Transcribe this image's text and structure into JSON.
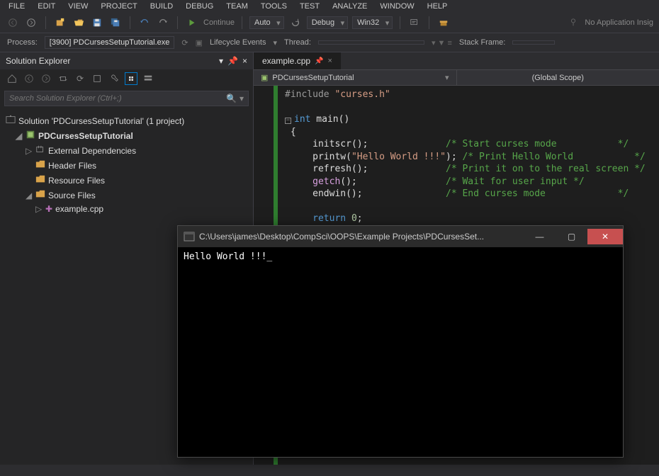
{
  "menu": [
    "FILE",
    "EDIT",
    "VIEW",
    "PROJECT",
    "BUILD",
    "DEBUG",
    "TEAM",
    "TOOLS",
    "TEST",
    "ANALYZE",
    "WINDOW",
    "HELP"
  ],
  "toolbar": {
    "continue_label": "Continue",
    "config": "Auto",
    "solution_config": "Debug",
    "platform": "Win32",
    "no_app": "No Application Insig"
  },
  "toolbar2": {
    "process_label": "Process:",
    "process_value": "[3900] PDCursesSetupTutorial.exe",
    "lifecycle": "Lifecycle Events",
    "thread": "Thread:",
    "stack": "Stack Frame:"
  },
  "sidebar": {
    "title": "Solution Explorer",
    "search_placeholder": "Search Solution Explorer (Ctrl+;)",
    "solution": "Solution 'PDCursesSetupTutorial' (1 project)",
    "project": "PDCursesSetupTutorial",
    "nodes": {
      "ext": "External Dependencies",
      "header": "Header Files",
      "resource": "Resource Files",
      "source": "Source Files",
      "example": "example.cpp"
    }
  },
  "editor": {
    "tab": "example.cpp",
    "scope_project": "PDCursesSetupTutorial",
    "scope_global": "(Global Scope)"
  },
  "code": {
    "lines": [
      {
        "t": "include",
        "pre": "#include ",
        "str": "\"curses.h\""
      },
      {
        "t": "blank"
      },
      {
        "t": "sig",
        "kw": "int",
        "rest": " main()",
        "box": true
      },
      {
        "t": "plain",
        "txt": "{"
      },
      {
        "t": "call",
        "fn": "initscr",
        "args": "();",
        "pad": "              ",
        "cmt": "/* Start curses mode           */"
      },
      {
        "t": "call",
        "fn": "printw",
        "args": "(",
        "str": "\"Hello World !!!\"",
        "post": ");",
        "pad": " ",
        "cmt": "/* Print Hello World           */"
      },
      {
        "t": "call",
        "fn": "refresh",
        "args": "();",
        "pad": "              ",
        "cmt": "/* Print it on to the real screen */"
      },
      {
        "t": "call",
        "fn": "getch",
        "args": "();",
        "pad": "                ",
        "cmt": "/* Wait for user input */",
        "fnClass": "c-func"
      },
      {
        "t": "call",
        "fn": "endwin",
        "args": "();",
        "pad": "               ",
        "cmt": "/* End curses mode             */"
      },
      {
        "t": "blank"
      },
      {
        "t": "return",
        "kw": "return",
        "num": "0",
        "post": ";"
      },
      {
        "t": "plain",
        "txt": "}"
      }
    ]
  },
  "console": {
    "title_path": "C:\\Users\\james\\Desktop\\CompSci\\OOPS\\Example Projects\\PDCursesSet...",
    "output": "Hello World !!!"
  }
}
